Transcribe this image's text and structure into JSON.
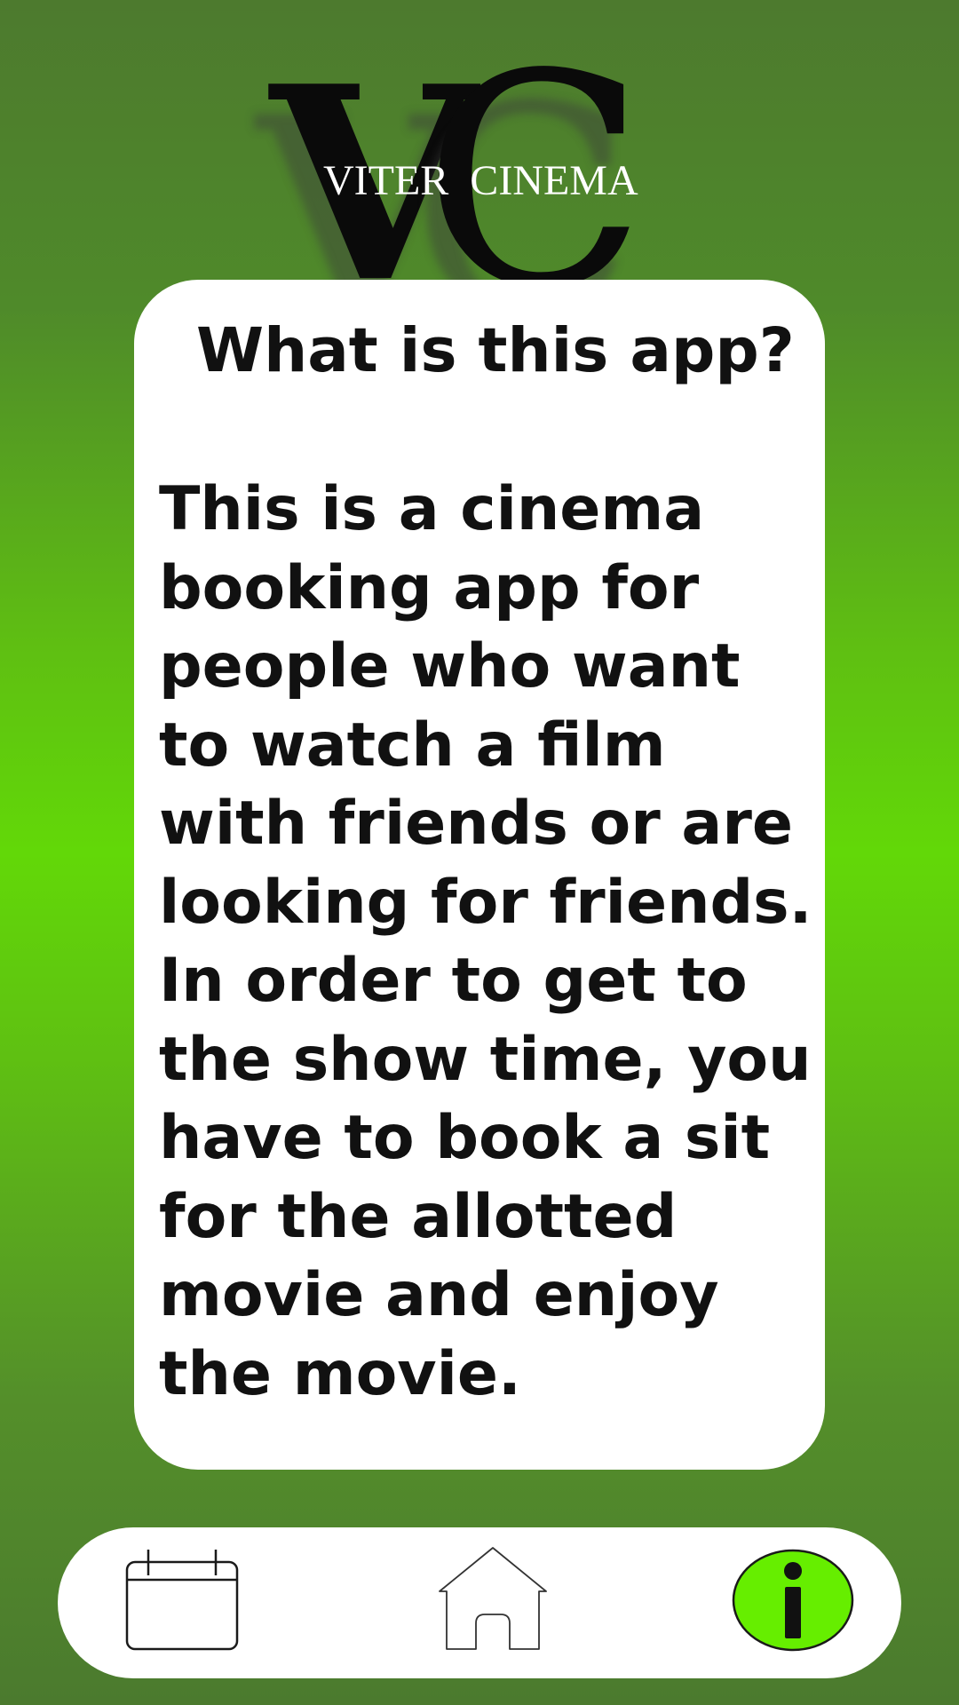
{
  "logo": {
    "monogram_v": "V",
    "monogram_c": "C",
    "name": "VITER  CINEMA"
  },
  "card": {
    "title": "What is this app?",
    "body": "This is a cinema booking app for people who want to watch a film with friends or are looking for friends. In order to get to the show time, you have to book a sit for the allotted movie and enjoy the movie."
  },
  "nav": {
    "items": [
      {
        "icon": "calendar-icon",
        "active": false
      },
      {
        "icon": "home-icon",
        "active": false
      },
      {
        "icon": "info-icon",
        "active": true
      }
    ],
    "active_color": "#66ee00"
  },
  "colors": {
    "background_accent": "#62d808",
    "card": "#ffffff",
    "text": "#111111"
  }
}
